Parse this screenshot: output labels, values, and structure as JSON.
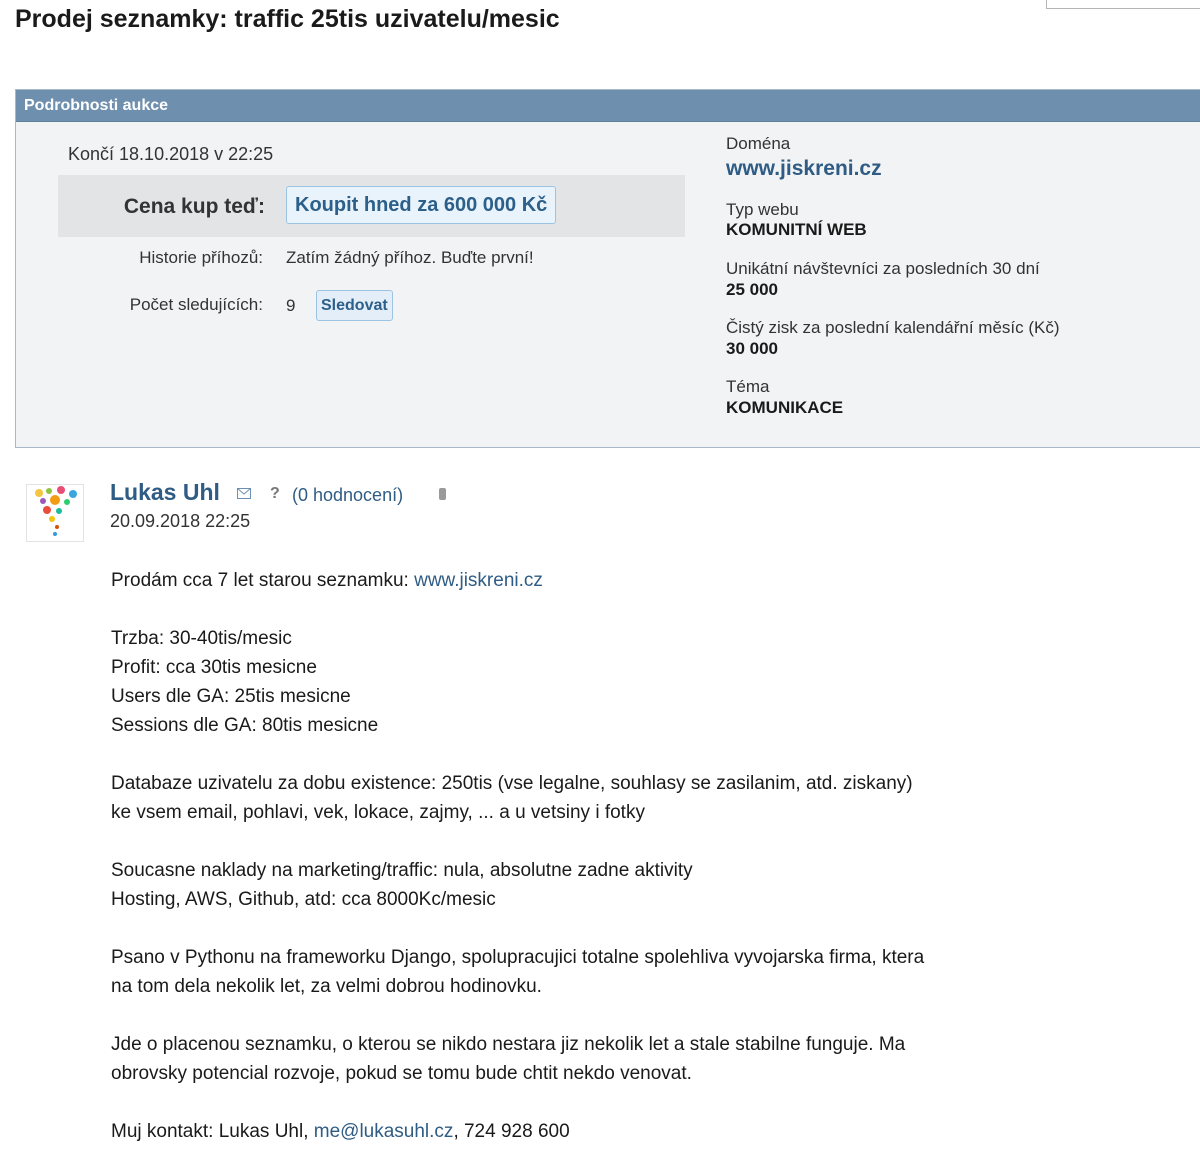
{
  "page": {
    "title": "Prodej seznamky: traffic 25tis uzivatelu/mesic"
  },
  "auction": {
    "header": "Podrobnosti aukce",
    "ends": "Končí 18.10.2018 v 22:25",
    "price_label": "Cena kup teď:",
    "buy_button": "Koupit hned za 600 000 Kč",
    "history_label": "Historie příhozů:",
    "history_value": "Zatím žádný příhoz. Buďte první!",
    "watchers_label": "Počet sledujících:",
    "watchers_count": "9",
    "follow_button": "Sledovat",
    "domain_label": "Doména",
    "domain_value": "www.jiskreni.cz",
    "web_type_label": "Typ webu",
    "web_type_value": "KOMUNITNÍ WEB",
    "visitors_label": "Unikátní návštevníci za posledních 30 dní",
    "visitors_value": "25 000",
    "profit_label": "Čistý zisk za poslední kalendářní měsíc (Kč)",
    "profit_value": "30 000",
    "topic_label": "Téma",
    "topic_value": "KOMUNIKACE"
  },
  "post": {
    "author": "Lukas Uhl",
    "help": "?",
    "rating": "(0 hodnocení)",
    "date": "20.09.2018 22:25",
    "intro_text": "Prodám cca 7 let starou seznamku: ",
    "intro_link": "www.jiskreni.cz",
    "paragraphs": {
      "stats": [
        "Trzba: 30-40tis/mesic",
        "Profit: cca 30tis mesicne",
        "Users dle GA: 25tis mesicne",
        "Sessions dle GA: 80tis mesicne"
      ],
      "database": [
        "Databaze uzivatelu za dobu existence: 250tis (vse legalne, souhlasy se zasilanim, atd. ziskany)",
        "ke vsem email, pohlavi, vek, lokace, zajmy, ... a u vetsiny i fotky"
      ],
      "costs": [
        "Soucasne naklady na marketing/traffic: nula, absolutne zadne aktivity",
        "Hosting, AWS, Github, atd: cca 8000Kc/mesic"
      ],
      "tech": [
        "Psano v Pythonu na frameworku Django, spolupracujici totalne spolehliva vyvojarska firma, ktera",
        "na tom dela nekolik let, za velmi dobrou hodinovku."
      ],
      "pitch": [
        "Jde o placenou seznamku, o kterou se nikdo nestara jiz nekolik let a stale stabilne funguje. Ma",
        "obrovsky potencial rozvoje, pokud se tomu bude chtit nekdo venovat."
      ]
    },
    "contact_prefix": "Muj kontakt: Lukas Uhl, ",
    "contact_email": "me@lukasuhl.cz",
    "contact_suffix": ", 724 928 600"
  },
  "colors": {
    "header_bg": "#6e8fad",
    "link": "#2f5c84",
    "panel_bg": "#f2f3f4"
  },
  "icons": [
    "mail-icon",
    "help-icon",
    "phone-icon",
    "avatar"
  ]
}
